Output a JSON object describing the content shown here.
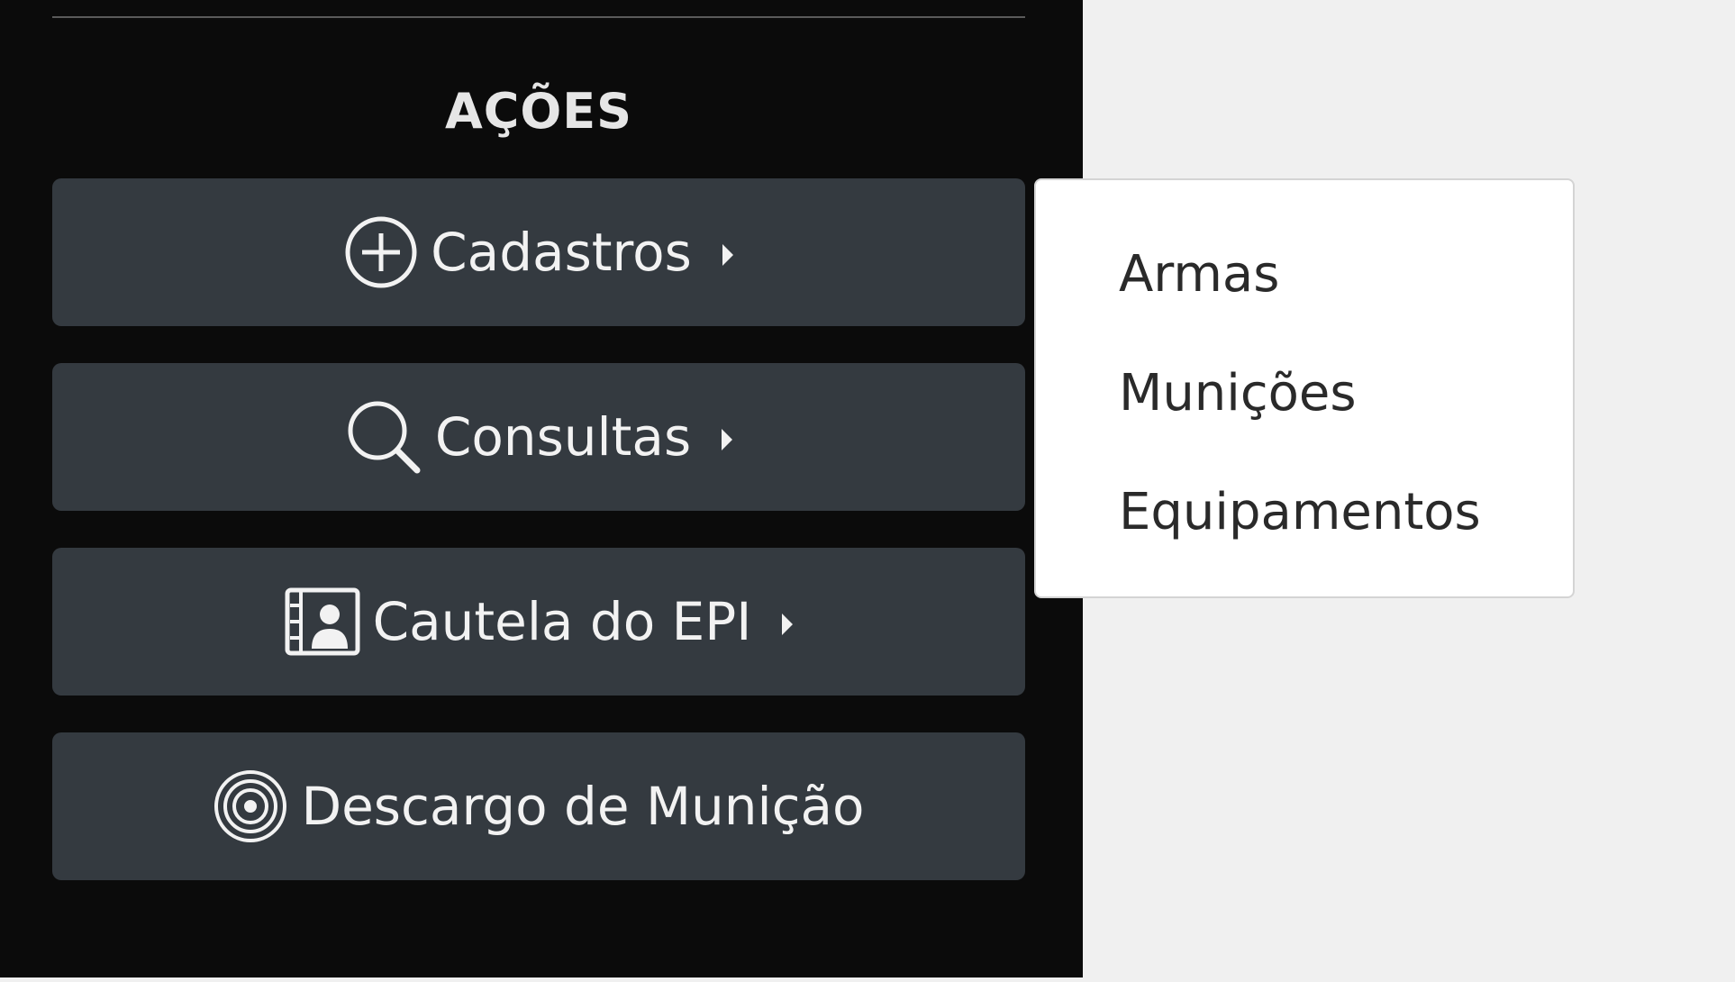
{
  "sidebar": {
    "section_title": "AÇÕES",
    "actions": [
      {
        "label": "Cadastros",
        "icon": "plus-circle-icon",
        "has_submenu": true
      },
      {
        "label": "Consultas",
        "icon": "search-icon",
        "has_submenu": true
      },
      {
        "label": "Cautela do EPI",
        "icon": "id-card-icon",
        "has_submenu": true
      },
      {
        "label": "Descargo de Munição",
        "icon": "target-icon",
        "has_submenu": false
      }
    ]
  },
  "dropdown": {
    "items": [
      {
        "label": "Armas"
      },
      {
        "label": "Munições"
      },
      {
        "label": "Equipamentos"
      }
    ]
  },
  "colors": {
    "sidebar_bg": "#0b0b0b",
    "button_bg": "#343a40",
    "button_text": "#f2f2f2",
    "page_bg": "#f0f0f0",
    "dropdown_bg": "#ffffff",
    "dropdown_text": "#2a2a2a"
  }
}
